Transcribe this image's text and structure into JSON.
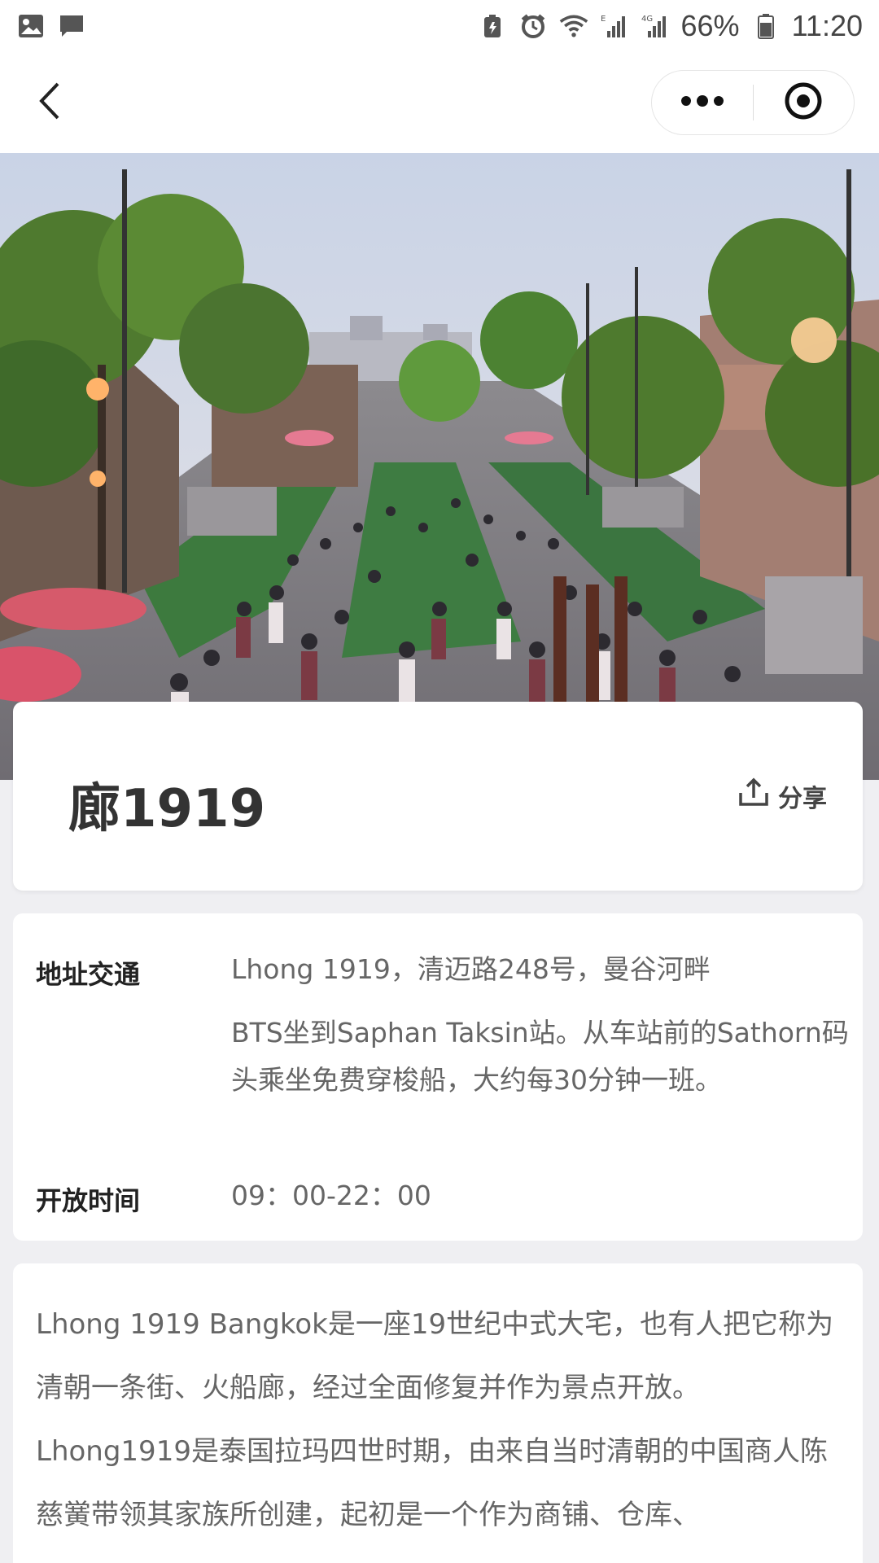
{
  "status_bar": {
    "battery": "66%",
    "time": "11:20",
    "icons": [
      "image-icon",
      "message-icon",
      "battery-saver-icon",
      "alarm-icon",
      "wifi-icon",
      "signal-e-icon",
      "signal-4g-icon",
      "battery-icon"
    ]
  },
  "nav": {
    "back_icon": "chevron-left-icon",
    "more_icon": "more-dots-icon",
    "close_icon": "target-circle-icon"
  },
  "place": {
    "title": "廊1919",
    "share_label": "分享"
  },
  "info": {
    "address_label": "地址交通",
    "address_value": "Lhong 1919，清迈路248号，曼谷河畔",
    "transport_value": "BTS坐到Saphan Taksin站。从车站前的Sathorn码头乘坐免费穿梭船，大约每30分钟一班。",
    "hours_label": "开放时间",
    "hours_value": "09：00-22：00"
  },
  "description": {
    "p1": "Lhong 1919 Bangkok是一座19世纪中式大宅，也有人把它称为清朝一条街、火船廊，经过全面修复并作为景点开放。",
    "p2": "Lhong1919是泰国拉玛四世时期，由来自当时清朝的中国商人陈慈黉带领其家族所创建，起初是一个作为商铺、仓库、"
  }
}
